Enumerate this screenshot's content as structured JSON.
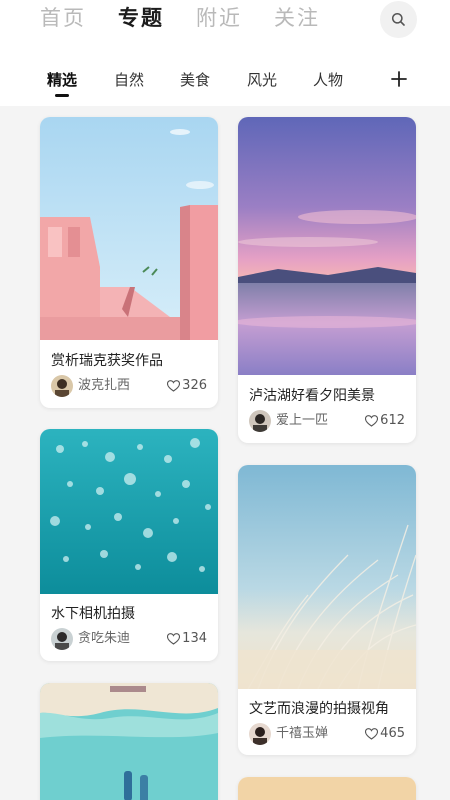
{
  "top_tabs": [
    {
      "label": "首页"
    },
    {
      "label": "专题"
    },
    {
      "label": "附近"
    },
    {
      "label": "关注"
    }
  ],
  "search_icon": "search-icon",
  "categories": [
    {
      "label": "精选"
    },
    {
      "label": "自然"
    },
    {
      "label": "美食"
    },
    {
      "label": "风光"
    },
    {
      "label": "人物"
    }
  ],
  "add_category_icon": "plus-icon",
  "cards": [
    {
      "title": "赏析瑞克获奖作品",
      "author": "波克扎西",
      "likes": "326"
    },
    {
      "title": "泸沽湖好看夕阳美景",
      "author": "爱上一匹",
      "likes": "612"
    },
    {
      "title": "水下相机拍摄",
      "author": "贪吃朱迪",
      "likes": "134"
    },
    {
      "title": "文艺而浪漫的拍摄视角",
      "author": "千禧玉婵",
      "likes": "465"
    }
  ],
  "colors": {
    "active_text": "#1c1c1c",
    "inactive_text": "#b9b9b9",
    "page_bg": "#f4f4f4",
    "card_bg": "#ffffff"
  }
}
